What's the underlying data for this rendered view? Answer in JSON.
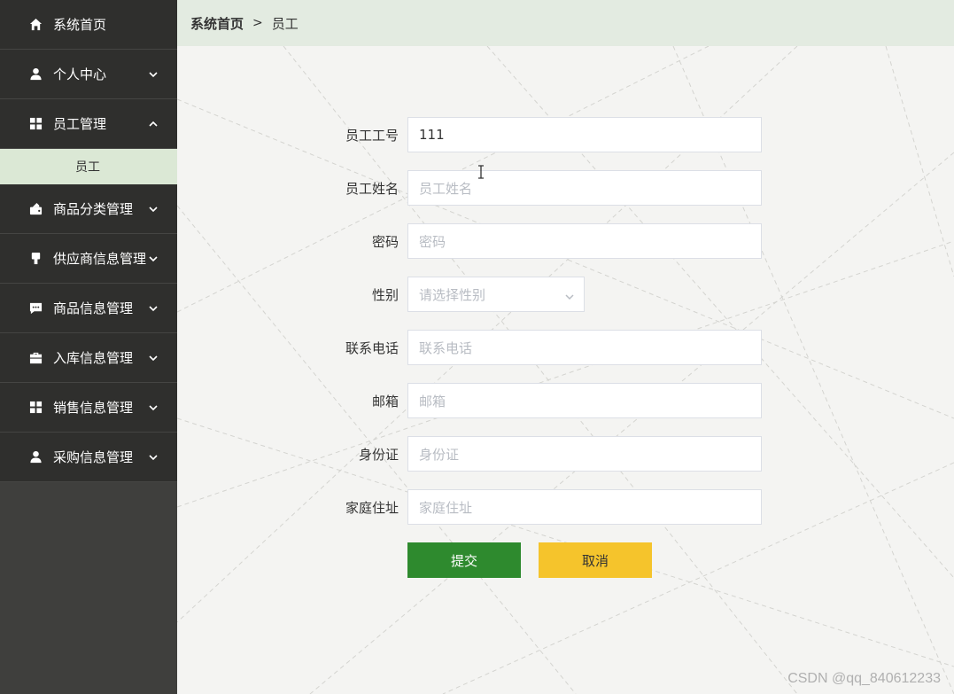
{
  "sidebar": {
    "items": [
      {
        "label": "系统首页",
        "icon": "home-icon",
        "arrow": ""
      },
      {
        "label": "个人中心",
        "icon": "user-icon",
        "arrow": "down"
      },
      {
        "label": "员工管理",
        "icon": "grid-icon",
        "arrow": "up"
      },
      {
        "label": "商品分类管理",
        "icon": "wallet-icon",
        "arrow": "down"
      },
      {
        "label": "供应商信息管理",
        "icon": "brush-icon",
        "arrow": "down"
      },
      {
        "label": "商品信息管理",
        "icon": "chat-icon",
        "arrow": "down"
      },
      {
        "label": "入库信息管理",
        "icon": "briefcase-icon",
        "arrow": "down"
      },
      {
        "label": "销售信息管理",
        "icon": "grid-icon",
        "arrow": "down"
      },
      {
        "label": "采购信息管理",
        "icon": "user-icon",
        "arrow": "down"
      }
    ],
    "submenu": {
      "label": "员工"
    }
  },
  "breadcrumb": {
    "home": "系统首页",
    "separator": ">",
    "current": "员工"
  },
  "form": {
    "fields": [
      {
        "label": "员工工号",
        "value": "111",
        "placeholder": ""
      },
      {
        "label": "员工姓名",
        "value": "",
        "placeholder": "员工姓名"
      },
      {
        "label": "密码",
        "value": "",
        "placeholder": "密码"
      },
      {
        "label": "性别",
        "value": "",
        "placeholder": "请选择性别"
      },
      {
        "label": "联系电话",
        "value": "",
        "placeholder": "联系电话"
      },
      {
        "label": "邮箱",
        "value": "",
        "placeholder": "邮箱"
      },
      {
        "label": "身份证",
        "value": "",
        "placeholder": "身份证"
      },
      {
        "label": "家庭住址",
        "value": "",
        "placeholder": "家庭住址"
      }
    ],
    "submit_label": "提交",
    "cancel_label": "取消"
  },
  "watermark": "CSDN @qq_840612233",
  "colors": {
    "sidebar_bg": "#3f3f3d",
    "menu_bg": "#2f2f2d",
    "submenu_bg": "#dbe8d5",
    "header_bg": "#e3ebe1",
    "submit": "#2e8a2e",
    "cancel": "#f5c42c"
  }
}
